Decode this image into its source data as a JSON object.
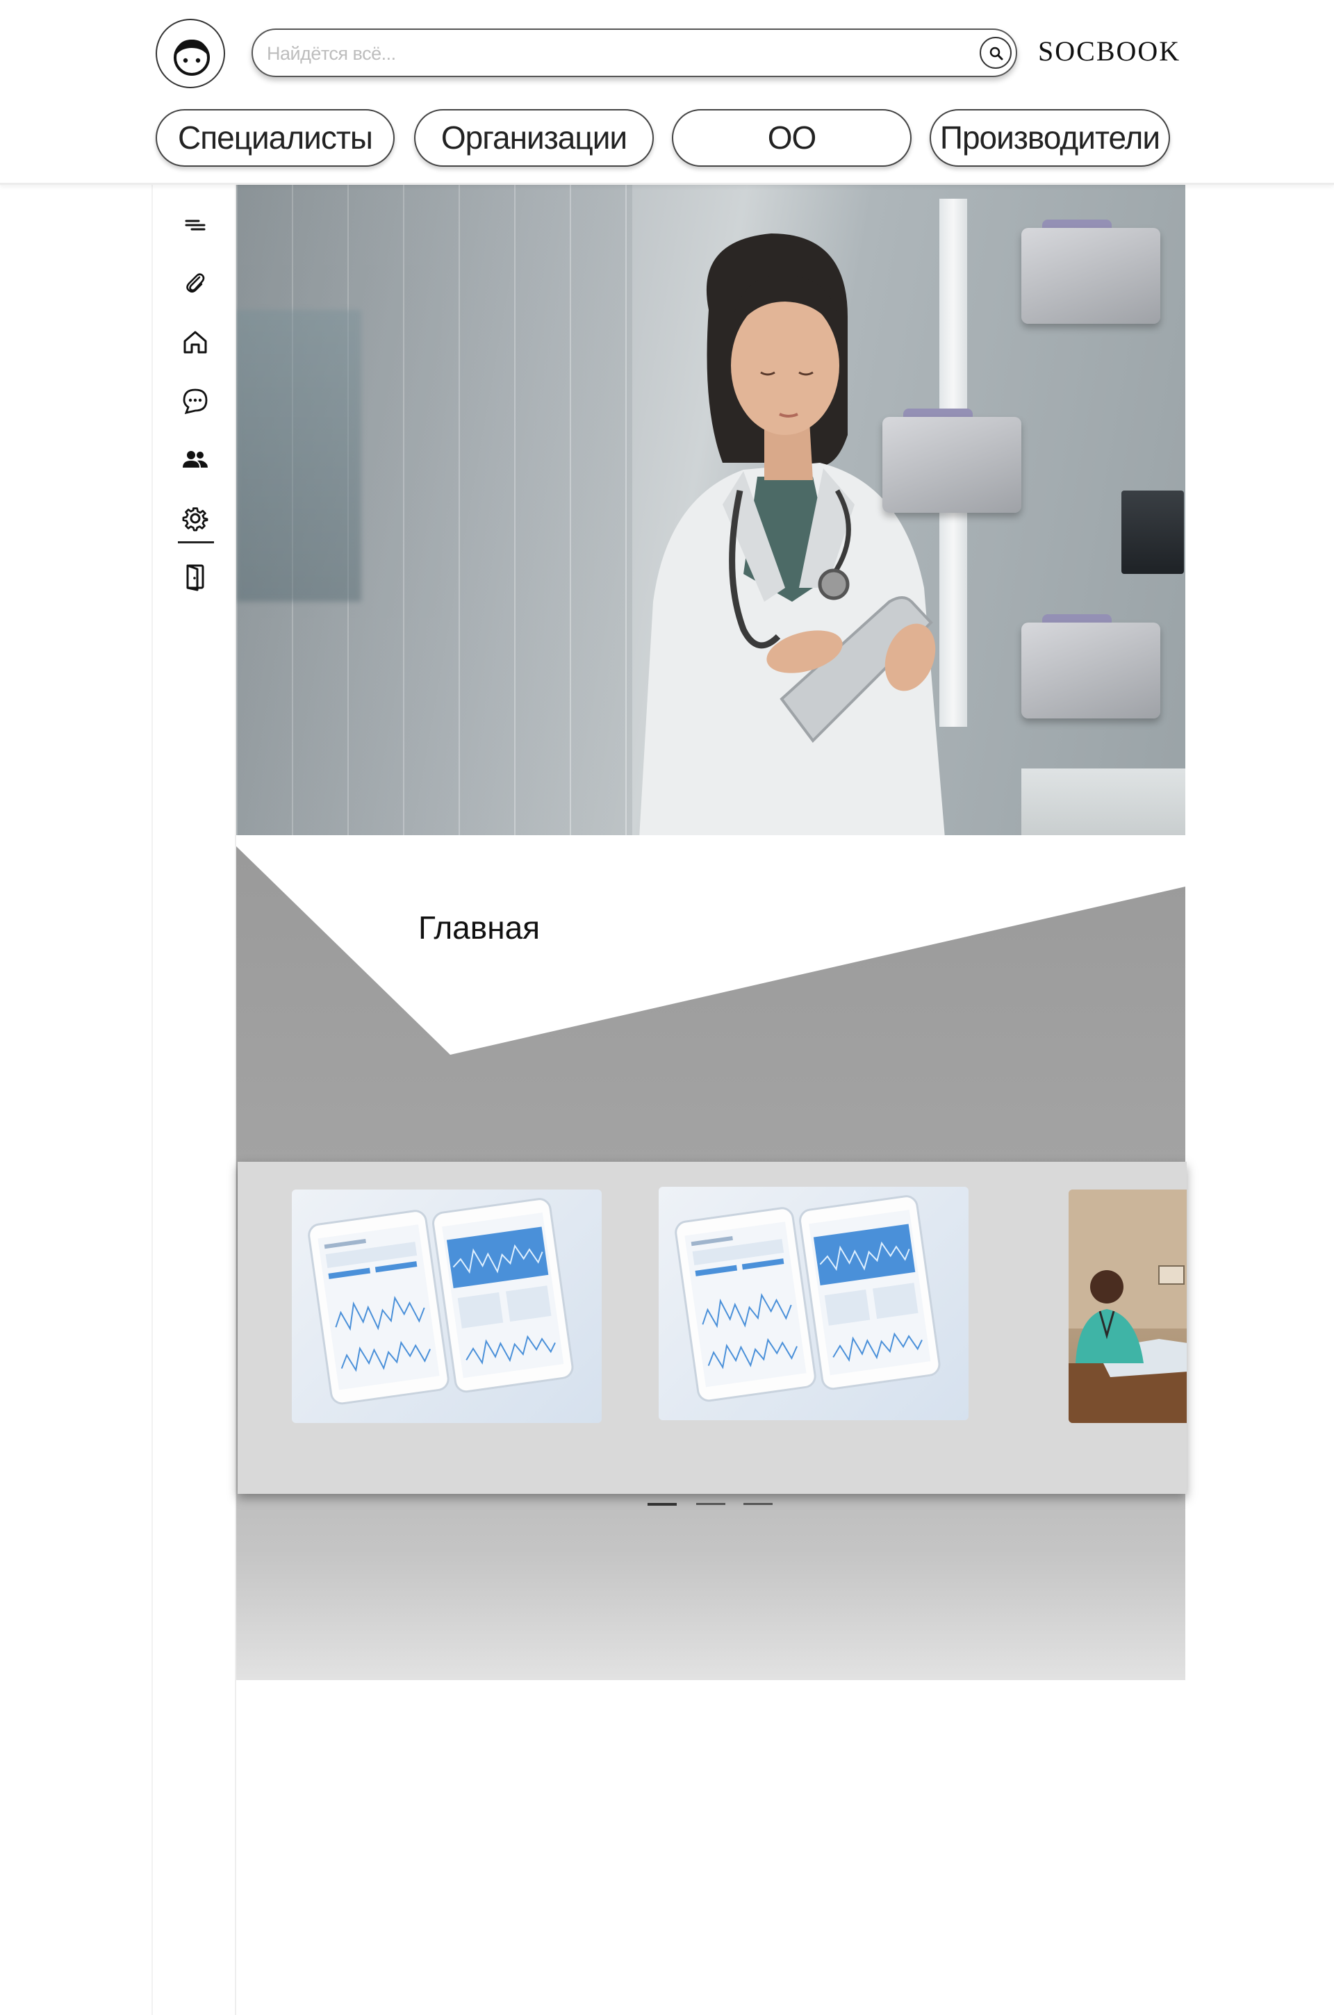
{
  "header": {
    "search": {
      "placeholder": "Найдётся всё..."
    },
    "brand": "SOCBOOK",
    "tabs": [
      {
        "label": "Специалисты"
      },
      {
        "label": "Организации"
      },
      {
        "label": "ОО"
      },
      {
        "label": "Производители"
      }
    ]
  },
  "sidebar": {
    "items": [
      {
        "icon": "menu-icon"
      },
      {
        "icon": "paperclip-icon"
      },
      {
        "icon": "home-icon",
        "active": true
      },
      {
        "icon": "chat-icon"
      },
      {
        "icon": "users-icon"
      },
      {
        "icon": "settings-icon"
      },
      {
        "icon": "logout-icon"
      }
    ]
  },
  "main": {
    "title": "Главная"
  },
  "carousel": {
    "slides": [
      {
        "type": "tablets-mockup"
      },
      {
        "type": "tablets-mockup"
      },
      {
        "type": "photo"
      }
    ],
    "indicators": 3,
    "active_index": 0
  }
}
